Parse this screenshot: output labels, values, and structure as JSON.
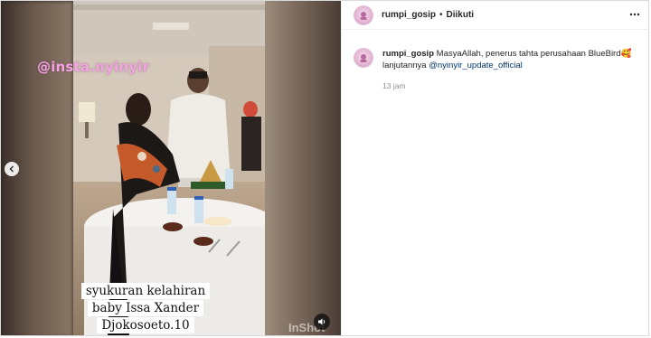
{
  "post": {
    "media": {
      "watermark": "@insta.nyinyir",
      "caption_lines": [
        "syukuran kelahiran",
        "baby Issa Xander",
        "Djokosoeto.10"
      ],
      "app_watermark": "InShot"
    },
    "header": {
      "username": "rumpi_gosip",
      "separator": "•",
      "follow_status": "Diikuti",
      "more_icon": "more-horizontal-icon"
    },
    "comment": {
      "username": "rumpi_gosip",
      "text": "MasyaAllah, penerus tahta perusahaan BlueBird",
      "emoji": "🥰",
      "text_continued": "lanjutannya",
      "mention": "@nyinyir_update_official",
      "time": "13 jam"
    },
    "controls": {
      "prev_icon": "chevron-left-icon",
      "audio_icon": "speaker-icon"
    }
  }
}
